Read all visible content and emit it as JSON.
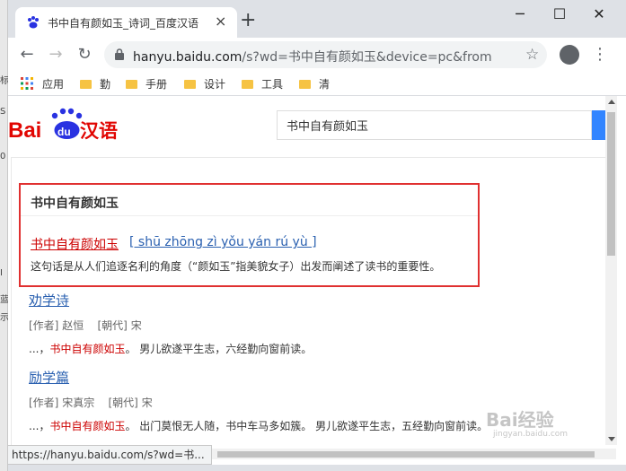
{
  "desktop_sliver": [
    "标",
    "S",
    "0",
    "I",
    "蓝",
    "示"
  ],
  "browser": {
    "tab_title": "书中自有颜如玉_诗词_百度汉语",
    "tab_close": "×",
    "new_tab": "+",
    "window_controls": {
      "minimize": "─",
      "maximize": "☐",
      "close": "✕"
    },
    "url_host": "hanyu.baidu.com",
    "url_rest": "/s?wd=书中自有颜如玉&device=pc&from=h...",
    "bookmarks": [
      "应用",
      "勤",
      "手册",
      "设计",
      "工具",
      "清"
    ],
    "status_url": "https://hanyu.baidu.com/s?wd=书..."
  },
  "page": {
    "logo": {
      "bai": "Bai",
      "du": "du",
      "hanyu": "汉语"
    },
    "search_value": "书中自有颜如玉",
    "card": {
      "title": "书中自有颜如玉",
      "term": "书中自有颜如玉",
      "pinyin": "[ shū zhōng zì yǒu yán rú yù ]",
      "description": "这句话是从人们追逐名利的角度（“颜如玉”指美貌女子）出发而阐述了读书的重要性。"
    },
    "poems": [
      {
        "title": "劝学诗",
        "author_label": "[作者]",
        "author": "赵恒",
        "dynasty_label": "[朝代]",
        "dynasty": "宋",
        "line_prefix": "...，",
        "line_highlight": "书中自有颜如玉",
        "line_suffix": "。 男儿欲遂平生志，六经勤向窗前读。"
      },
      {
        "title": "励学篇",
        "author_label": "[作者]",
        "author": "宋真宗",
        "dynasty_label": "[朝代]",
        "dynasty": "宋",
        "line_prefix": "...，",
        "line_highlight": "书中自有颜如玉",
        "line_suffix": "。 出门莫恨无人随，书中车马多如簇。 男儿欲遂平生志，五经勤向窗前读。"
      }
    ],
    "watermark_main": "Bai经验",
    "watermark_sub": "jingyan.baidu.com"
  },
  "colors": {
    "accent_red": "#e03030",
    "link_blue": "#2a60b0",
    "highlight_red": "#cc0000",
    "search_blue": "#3385ff"
  }
}
